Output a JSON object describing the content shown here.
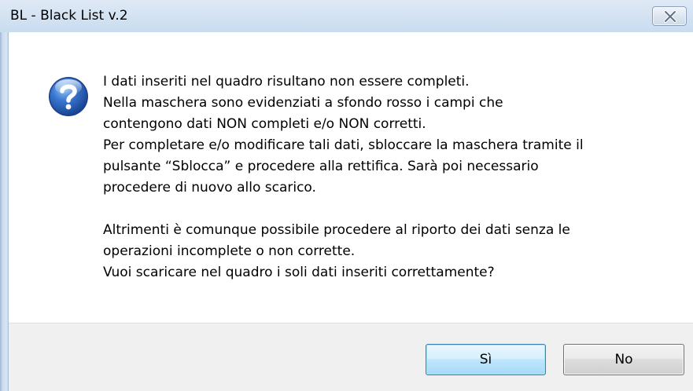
{
  "window": {
    "title": "BL - Black List v.2",
    "close_icon": "close-icon"
  },
  "message": {
    "icon": "question-icon",
    "lines": [
      "I dati inseriti nel quadro risultano non essere completi.",
      "Nella maschera sono evidenziati a sfondo rosso i campi che",
      "contengono dati NON completi e/o NON corretti.",
      "Per completare e/o modificare tali dati, sbloccare la maschera tramite il",
      "pulsante “Sblocca” e procedere alla rettifica. Sarà poi necessario",
      "procedere di nuovo allo scarico.",
      "Altrimenti è comunque possibile procedere al riporto dei dati senza le",
      "operazioni incomplete o non corrette.",
      "Vuoi scaricare nel quadro i soli dati inseriti correttamente?"
    ]
  },
  "buttons": {
    "yes_label": "Sì",
    "no_label": "No"
  },
  "colors": {
    "icon_blue": "#2a62b8",
    "default_button_border": "#3c7fb1",
    "footer_bg": "#f0f0f0"
  }
}
